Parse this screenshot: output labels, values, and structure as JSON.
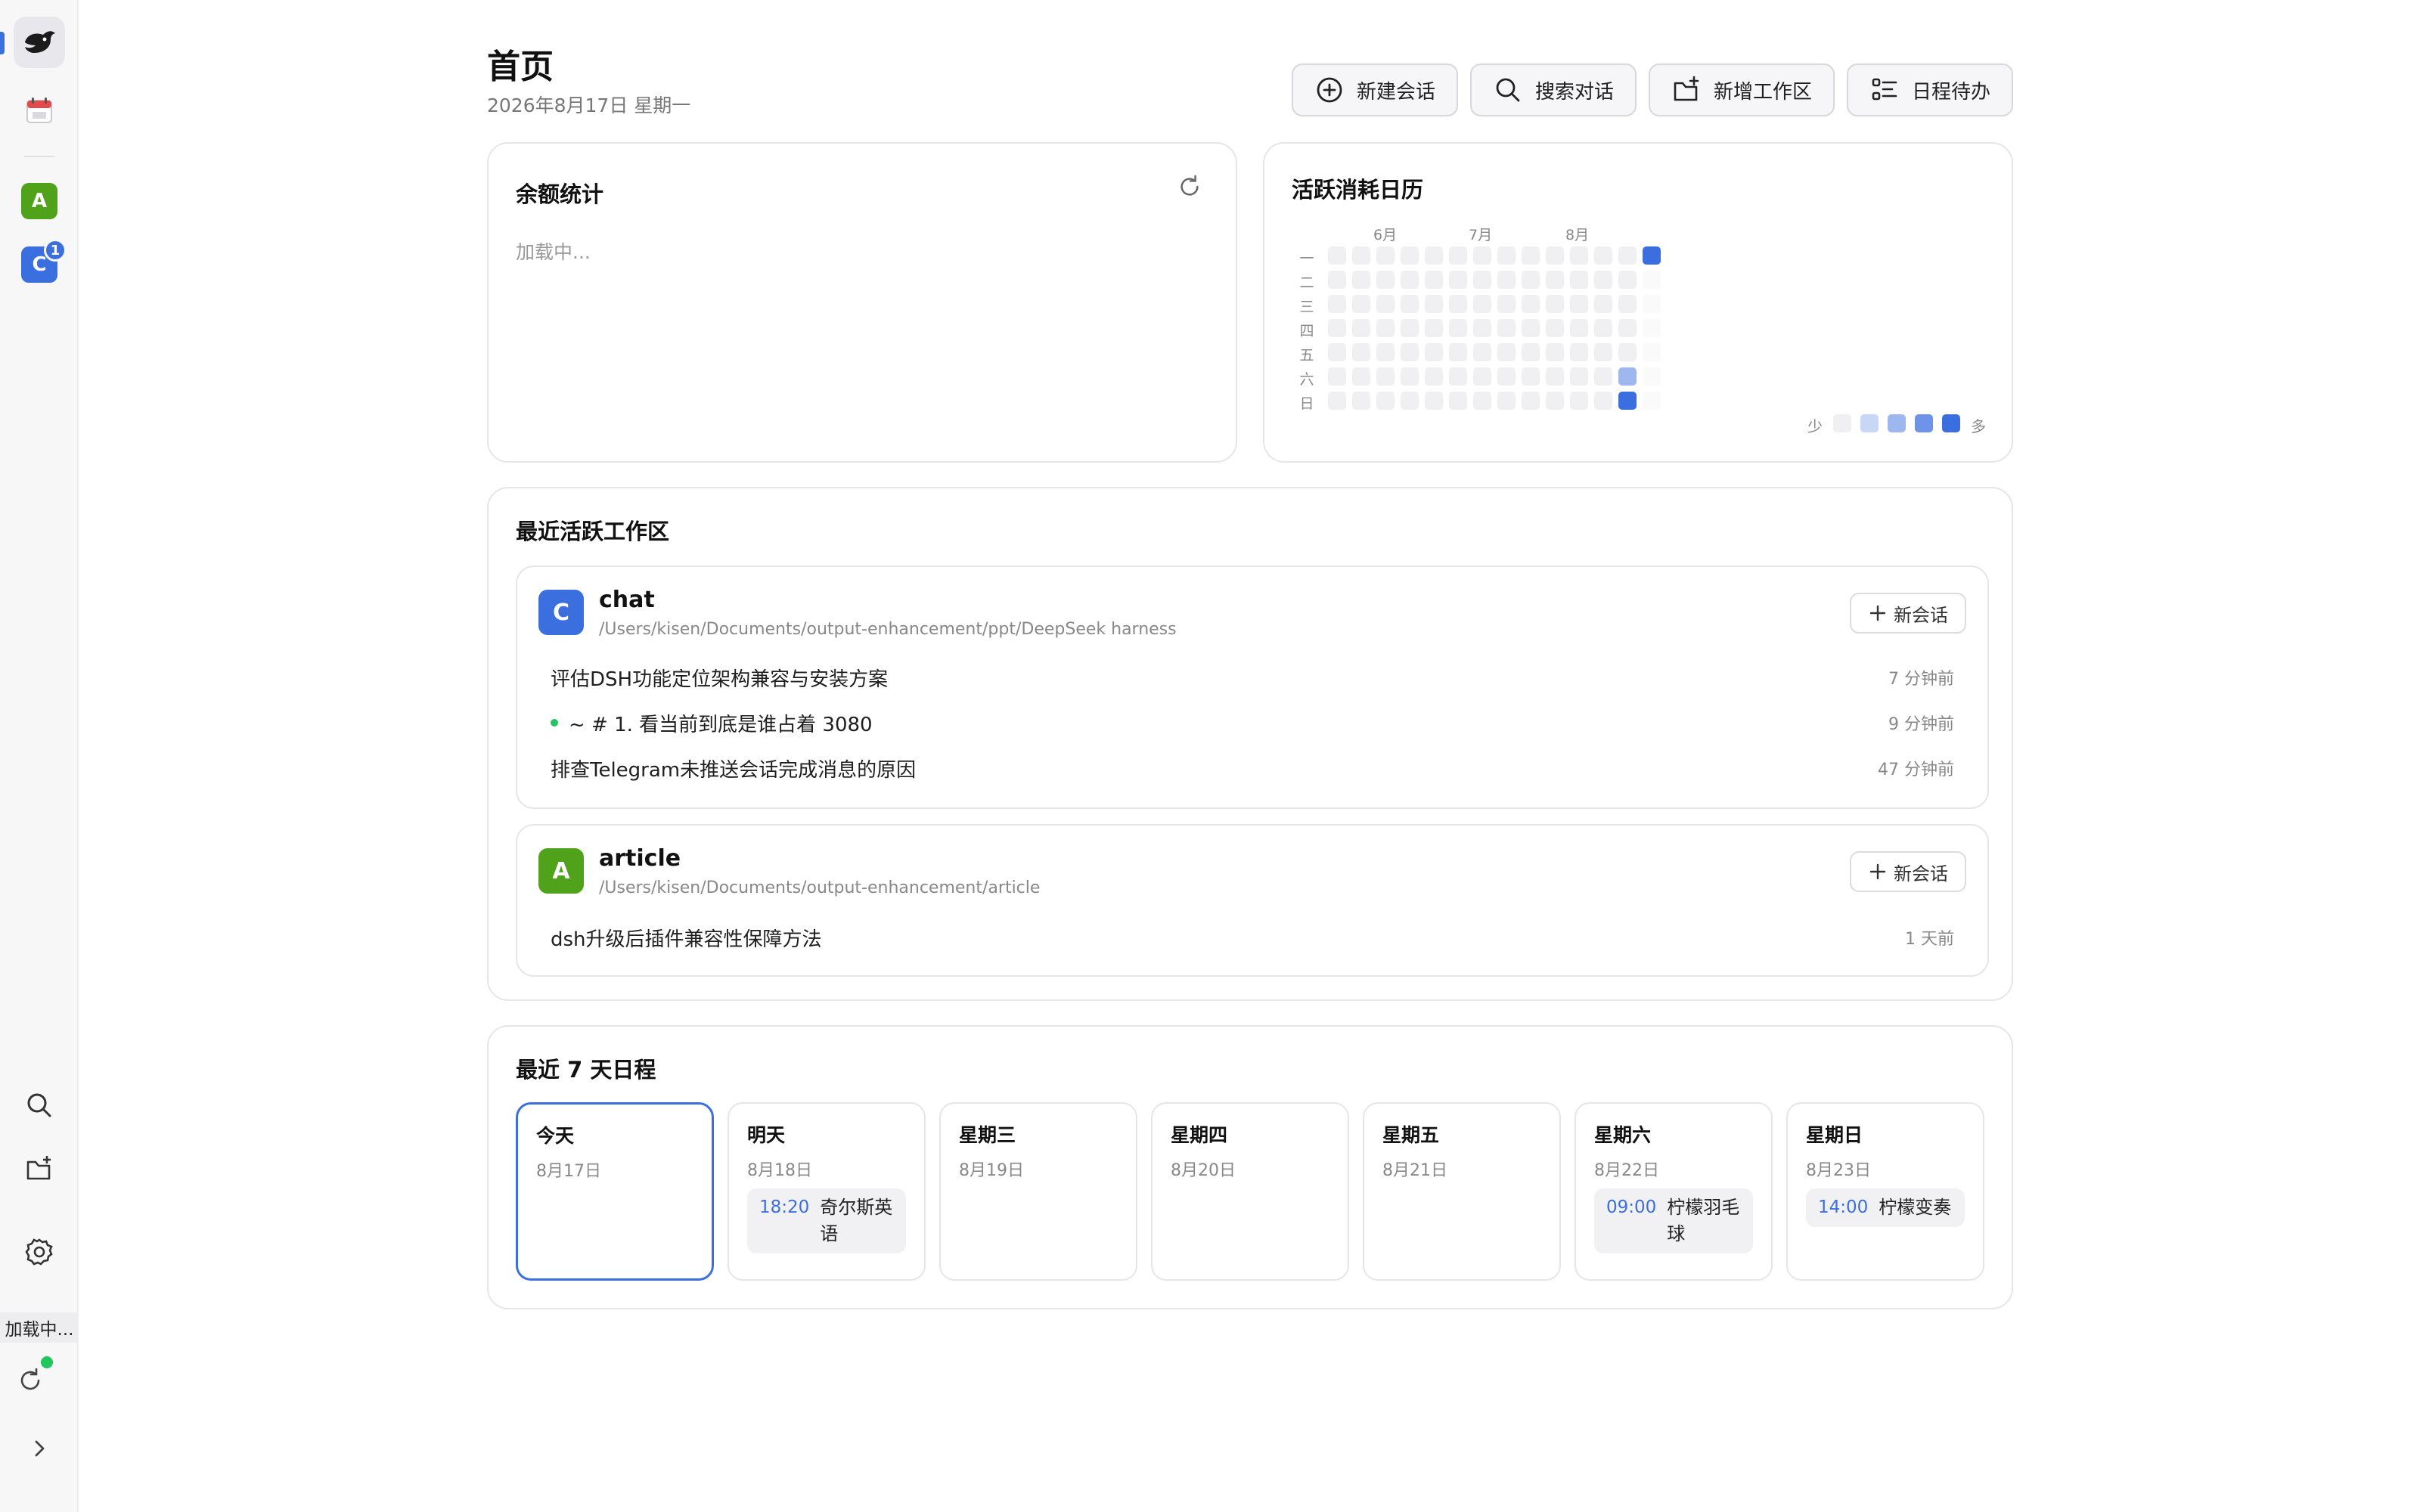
{
  "header": {
    "title": "首页",
    "date": "2026年8月17日 星期一"
  },
  "toolbar": {
    "new_chat": "新建会话",
    "search": "搜索对话",
    "new_workspace": "新增工作区",
    "schedule": "日程待办"
  },
  "sidebar": {
    "workspaces": [
      {
        "letter": "A",
        "color": "#4fa21a"
      },
      {
        "letter": "C",
        "color": "#3b6fe0",
        "badge": "1"
      }
    ],
    "loading": "加载中..."
  },
  "balance": {
    "title": "余额统计",
    "status": "加载中..."
  },
  "heatmap": {
    "title": "活跃消耗日历",
    "months": [
      "6月",
      "7月",
      "8月"
    ],
    "days": [
      "一",
      "二",
      "三",
      "四",
      "五",
      "六",
      "日"
    ],
    "active": [
      {
        "col": 12,
        "row": 5,
        "level": 2
      },
      {
        "col": 12,
        "row": 6,
        "level": 4
      },
      {
        "col": 13,
        "row": 0,
        "level": 4
      }
    ],
    "legend_less": "少",
    "legend_more": "多",
    "colors": [
      "#f0f0f2",
      "#c9d7f7",
      "#9fb7ef",
      "#6f93e8",
      "#3b6fe0"
    ]
  },
  "workspaces": {
    "title": "最近活跃工作区",
    "new_session_label": "新会话",
    "items": [
      {
        "letter": "C",
        "color": "#3b6fe0",
        "name": "chat",
        "path": "/Users/kisen/Documents/output-enhancement/ppt/DeepSeek harness",
        "sessions": [
          {
            "title": "评估DSH功能定位架构兼容与安装方案",
            "time": "7 分钟前",
            "active": false
          },
          {
            "title": "~ # 1. 看当前到底是谁占着 3080",
            "time": "9 分钟前",
            "active": true
          },
          {
            "title": "排查Telegram未推送会话完成消息的原因",
            "time": "47 分钟前",
            "active": false
          }
        ]
      },
      {
        "letter": "A",
        "color": "#4fa21a",
        "name": "article",
        "path": "/Users/kisen/Documents/output-enhancement/article",
        "sessions": [
          {
            "title": "dsh升级后插件兼容性保障方法",
            "time": "1 天前",
            "active": false
          }
        ]
      }
    ]
  },
  "schedule": {
    "title": "最近 7 天日程",
    "days": [
      {
        "name": "今天",
        "date": "8月17日",
        "today": true
      },
      {
        "name": "明天",
        "date": "8月18日",
        "event": {
          "time": "18:20",
          "title": "奇尔斯英语"
        }
      },
      {
        "name": "星期三",
        "date": "8月19日"
      },
      {
        "name": "星期四",
        "date": "8月20日"
      },
      {
        "name": "星期五",
        "date": "8月21日"
      },
      {
        "name": "星期六",
        "date": "8月22日",
        "event": {
          "time": "09:00",
          "title": "柠檬羽毛球"
        }
      },
      {
        "name": "星期日",
        "date": "8月23日",
        "event": {
          "time": "14:00",
          "title": "柠檬变奏"
        }
      }
    ]
  }
}
